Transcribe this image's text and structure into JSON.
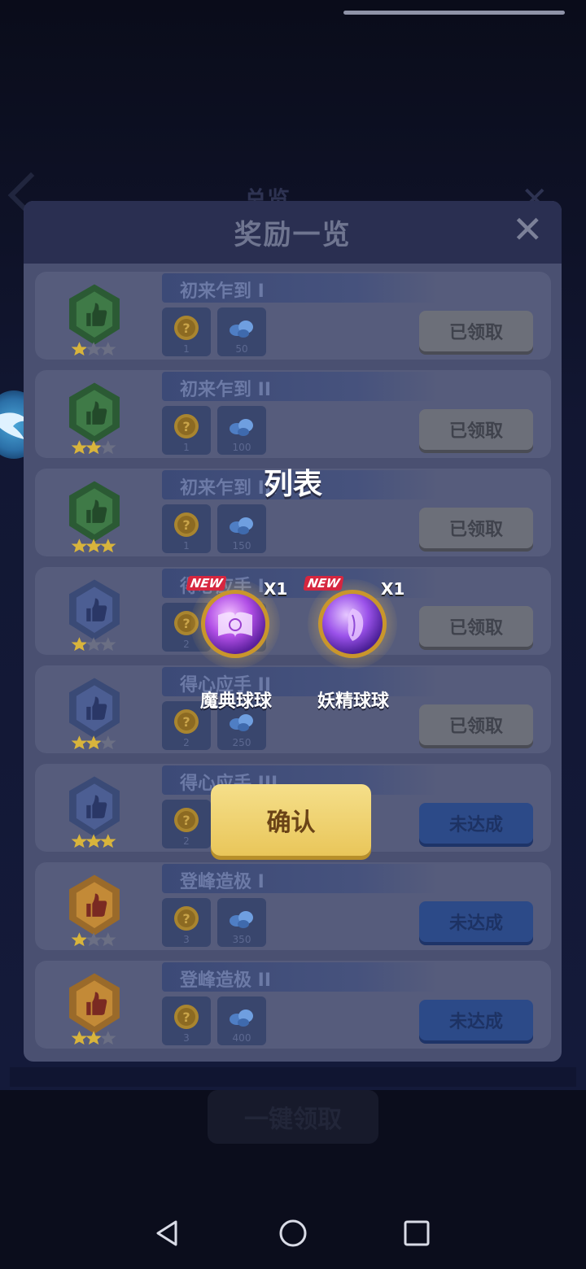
{
  "background": {
    "title": "总览",
    "footer_button": "一键领取"
  },
  "modal": {
    "title": "奖励一览",
    "close_icon": "close-icon",
    "rows": [
      {
        "title": "初来乍到 I",
        "badge_color": "green",
        "stars": 1,
        "reward1": "1",
        "reward2": "50",
        "button": "已领取",
        "state": "claimed"
      },
      {
        "title": "初来乍到 II",
        "badge_color": "green",
        "stars": 2,
        "reward1": "1",
        "reward2": "100",
        "button": "已领取",
        "state": "claimed"
      },
      {
        "title": "初来乍到 III",
        "badge_color": "green",
        "stars": 3,
        "reward1": "1",
        "reward2": "150",
        "button": "已领取",
        "state": "claimed"
      },
      {
        "title": "得心应手 I",
        "badge_color": "blue",
        "stars": 1,
        "reward1": "2",
        "reward2": "",
        "button": "已领取",
        "state": "claimed"
      },
      {
        "title": "得心应手 II",
        "badge_color": "blue",
        "stars": 2,
        "reward1": "2",
        "reward2": "250",
        "button": "已领取",
        "state": "claimed"
      },
      {
        "title": "得心应手 III",
        "badge_color": "blue",
        "stars": 3,
        "reward1": "2",
        "reward2": "",
        "button": "未达成",
        "state": "unreached"
      },
      {
        "title": "登峰造极 I",
        "badge_color": "gold",
        "stars": 1,
        "reward1": "3",
        "reward2": "350",
        "button": "未达成",
        "state": "unreached"
      },
      {
        "title": "登峰造极 II",
        "badge_color": "gold",
        "stars": 2,
        "reward1": "3",
        "reward2": "400",
        "button": "未达成",
        "state": "unreached"
      }
    ]
  },
  "popup": {
    "title": "列表",
    "items": [
      {
        "name": "魔典球球",
        "new_tag": "NEW",
        "quantity": "X1",
        "icon": "spellbook-orb-icon"
      },
      {
        "name": "妖精球球",
        "new_tag": "NEW",
        "quantity": "X1",
        "icon": "butterfly-orb-icon"
      }
    ],
    "confirm": "确认"
  },
  "colors": {
    "claimed_button": "#6c6f79",
    "unreached_button": "#2c4a88",
    "confirm_button": "#e9c65a"
  },
  "nav": {
    "back_icon": "back-triangle-icon",
    "home_icon": "home-circle-icon",
    "recents_icon": "recents-square-icon"
  }
}
